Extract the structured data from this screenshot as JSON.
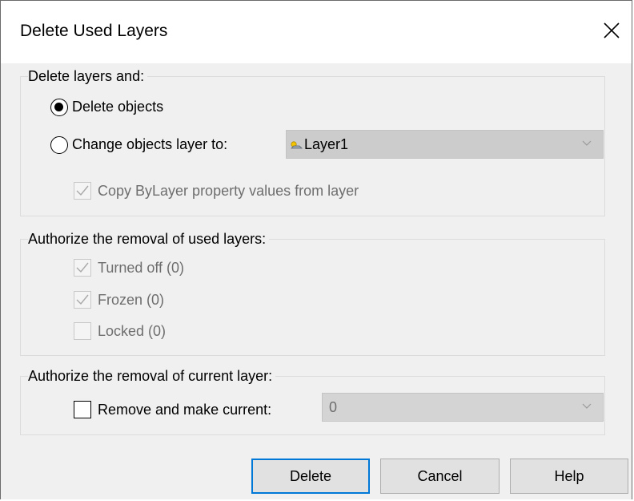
{
  "dialog": {
    "title": "Delete Used Layers"
  },
  "delete_group": {
    "legend": "Delete layers and:",
    "delete_objects_label": "Delete objects",
    "delete_objects_selected": true,
    "change_layer_label": "Change objects layer to:",
    "change_layer_selected": false,
    "layer_select_value": "Layer1",
    "layer_icon": "layer-sun-icon",
    "copy_bylayer_label": "Copy ByLayer property values from layer",
    "copy_bylayer_checked": true
  },
  "authorize_used": {
    "legend": "Authorize the removal of used layers:",
    "items": [
      {
        "label": "Turned off (0)",
        "checked": true
      },
      {
        "label": "Frozen (0)",
        "checked": true
      },
      {
        "label": "Locked (0)",
        "checked": false
      }
    ]
  },
  "authorize_current": {
    "legend": "Authorize the removal of current layer:",
    "remove_label": "Remove and make current:",
    "remove_checked": false,
    "current_select_value": "0"
  },
  "buttons": {
    "delete": "Delete",
    "cancel": "Cancel",
    "help": "Help"
  },
  "colors": {
    "default_button_border": "#0078d7",
    "dialog_background": "#f0f0f0"
  }
}
